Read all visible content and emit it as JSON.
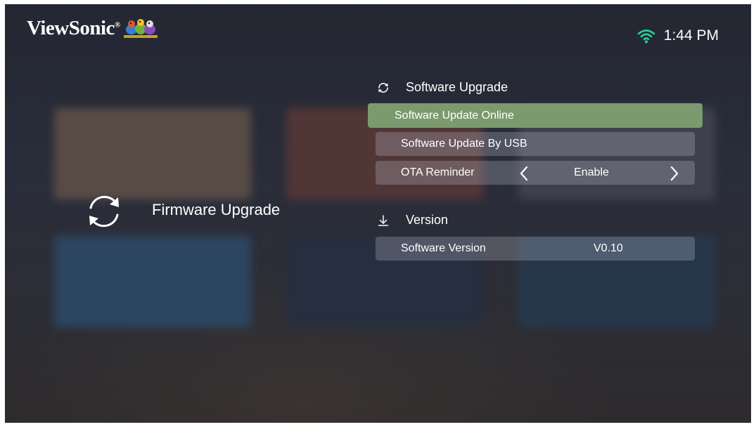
{
  "brand": {
    "logo_text": "ViewSonic",
    "logo_mark": "®"
  },
  "status_bar": {
    "wifi_icon": "wifi-icon",
    "time": "1:44 PM"
  },
  "left_panel": {
    "icon": "sync-icon",
    "title": "Firmware Upgrade"
  },
  "menu": {
    "software_upgrade": {
      "icon": "refresh-icon",
      "heading": "Software Upgrade",
      "items": [
        {
          "label": "Software Update Online",
          "focused": true
        },
        {
          "label": "Software Update By USB",
          "focused": false
        }
      ],
      "ota": {
        "label": "OTA Reminder",
        "value": "Enable"
      }
    },
    "version": {
      "icon": "download-arrow-icon",
      "heading": "Version",
      "row": {
        "label": "Software Version",
        "value": "V0.10"
      }
    }
  },
  "colors": {
    "focus_highlight": "#7b9a6e",
    "row_background": "rgba(190,190,205,0.28)",
    "text": "#ffffff"
  }
}
